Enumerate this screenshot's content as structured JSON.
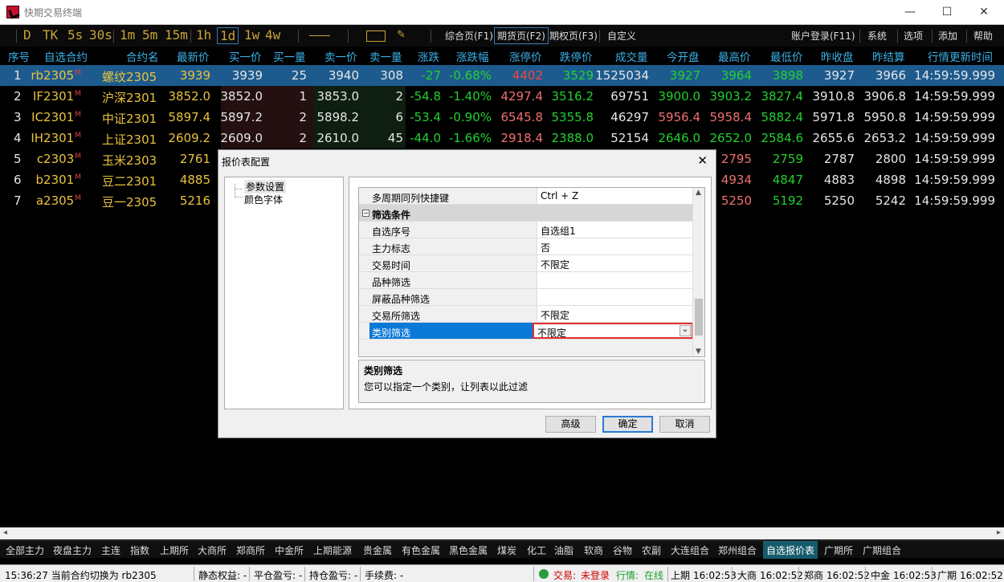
{
  "window": {
    "title": "快期交易终端",
    "minimize": "—",
    "maximize": "☐",
    "close": "✕"
  },
  "toolbar": {
    "timeframes": [
      "D",
      "TK",
      "5s",
      "30s",
      "1m",
      "5m",
      "15m",
      "1h",
      "1d",
      "1w",
      "4w"
    ],
    "selected_timeframe": "1d",
    "buttons": {
      "overview": "综合页(F1)",
      "futures": "期货页(F2)",
      "options": "期权页(F3)",
      "custom": "自定义",
      "account": "账户登录(F11)",
      "system": "系统",
      "options_menu": "选项",
      "add": "添加",
      "help": "帮助"
    }
  },
  "table": {
    "headers": [
      "序号",
      "自选合约",
      "合约名",
      "最新价",
      "买一价",
      "买一量",
      "卖一价",
      "卖一量",
      "涨跌",
      "涨跌幅",
      "涨停价",
      "跌停价",
      "成交量",
      "今开盘",
      "最高价",
      "最低价",
      "昨收盘",
      "昨结算",
      "行情更新时间"
    ],
    "rows": [
      {
        "idx": "1",
        "code": "rb2305",
        "m": "M",
        "name": "螺纹2305",
        "last": "3939",
        "bid": "3939",
        "bidvol": "25",
        "ask": "3940",
        "askvol": "308",
        "chg": "-27",
        "pct": "-0.68%",
        "up": "4402",
        "down": "3529",
        "vol": "1525034",
        "open": "3927",
        "high": "3964",
        "low": "3898",
        "close": "3927",
        "settle": "3966",
        "time": "14:59:59.999"
      },
      {
        "idx": "2",
        "code": "IF2301",
        "m": "M",
        "name": "沪深2301",
        "last": "3852.0",
        "bid": "3852.0",
        "bidvol": "1",
        "ask": "3853.0",
        "askvol": "2",
        "chg": "-54.8",
        "pct": "-1.40%",
        "up": "4297.4",
        "down": "3516.2",
        "vol": "69751",
        "open": "3900.0",
        "high": "3903.2",
        "low": "3827.4",
        "close": "3910.8",
        "settle": "3906.8",
        "time": "14:59:59.999"
      },
      {
        "idx": "3",
        "code": "IC2301",
        "m": "M",
        "name": "中证2301",
        "last": "5897.4",
        "bid": "5897.2",
        "bidvol": "2",
        "ask": "5898.2",
        "askvol": "6",
        "chg": "-53.4",
        "pct": "-0.90%",
        "up": "6545.8",
        "down": "5355.8",
        "vol": "46297",
        "open": "5956.4",
        "high": "5958.4",
        "low": "5882.4",
        "close": "5971.8",
        "settle": "5950.8",
        "time": "14:59:59.999"
      },
      {
        "idx": "4",
        "code": "IH2301",
        "m": "M",
        "name": "上证2301",
        "last": "2609.2",
        "bid": "2609.0",
        "bidvol": "2",
        "ask": "2610.0",
        "askvol": "45",
        "chg": "-44.0",
        "pct": "-1.66%",
        "up": "2918.4",
        "down": "2388.0",
        "vol": "52154",
        "open": "2646.0",
        "high": "2652.0",
        "low": "2584.6",
        "close": "2655.6",
        "settle": "2653.2",
        "time": "14:59:59.999"
      },
      {
        "idx": "5",
        "code": "c2303",
        "m": "M",
        "name": "玉米2303",
        "last": "2761",
        "high": "2795",
        "low": "2759",
        "close": "2787",
        "settle": "2800",
        "time": "14:59:59.999"
      },
      {
        "idx": "6",
        "code": "b2301",
        "m": "M",
        "name": "豆二2301",
        "last": "4885",
        "high": "4934",
        "low": "4847",
        "close": "4883",
        "settle": "4898",
        "time": "14:59:59.999"
      },
      {
        "idx": "7",
        "code": "a2305",
        "m": "M",
        "name": "豆一2305",
        "last": "5216",
        "high": "5250",
        "low": "5192",
        "close": "5250",
        "settle": "5242",
        "time": "14:59:59.999"
      }
    ]
  },
  "bottom_tabs": [
    "全部主力",
    "夜盘主力",
    "主连",
    "指数",
    "上期所",
    "大商所",
    "郑商所",
    "中金所",
    "上期能源",
    "贵金属",
    "有色金属",
    "黑色金属",
    "煤炭",
    "化工",
    "油脂",
    "软商",
    "谷物",
    "农副",
    "大连组合",
    "郑州组合",
    "自选报价表",
    "广期所",
    "广期组合"
  ],
  "active_bottom_tab": "自选报价表",
  "status": {
    "message": "15:36:27 当前合约切换为 rb2305",
    "equity": "静态权益: -",
    "close_pl": "平仓盈亏: -",
    "pos_pl": "持仓盈亏: -",
    "fee": "手续费: -",
    "trade_label": "交易:",
    "trade_val": "未登录",
    "quote_label": "行情:",
    "quote_val": "在线",
    "exchanges": [
      {
        "n": "上期",
        "t": "16:02:53"
      },
      {
        "n": "大商",
        "t": "16:02:52"
      },
      {
        "n": "郑商",
        "t": "16:02:52"
      },
      {
        "n": "中金",
        "t": "16:02:53"
      },
      {
        "n": "广期",
        "t": "16:02:52"
      }
    ]
  },
  "dialog": {
    "title": "报价表配置",
    "tree": [
      "参数设置",
      "颜色字体"
    ],
    "top_row": {
      "name": "多周期同列快捷键",
      "value": "Ctrl + Z"
    },
    "category": "筛选条件",
    "props": [
      {
        "name": "自选序号",
        "value": "自选组1"
      },
      {
        "name": "主力标志",
        "value": "否"
      },
      {
        "name": "交易时间",
        "value": "不限定"
      },
      {
        "name": "品种筛选",
        "value": ""
      },
      {
        "name": "屏蔽品种筛选",
        "value": ""
      },
      {
        "name": "交易所筛选",
        "value": "不限定"
      },
      {
        "name": "类别筛选",
        "value": "不限定"
      }
    ],
    "desc_title": "类别筛选",
    "desc_text": "您可以指定一个类别，让列表以此过滤",
    "buttons": {
      "advanced": "高级",
      "ok": "确定",
      "cancel": "取消"
    }
  }
}
